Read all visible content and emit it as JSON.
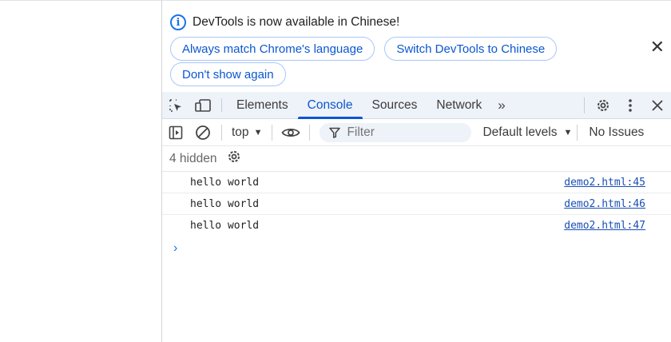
{
  "infobar": {
    "message": "DevTools is now available in Chinese!",
    "buttons": [
      "Always match Chrome's language",
      "Switch DevTools to Chinese",
      "Don't show again"
    ],
    "close_symbol": "✕"
  },
  "tabs": {
    "items": [
      "Elements",
      "Console",
      "Sources",
      "Network"
    ],
    "active": "Console",
    "more_symbol": "»"
  },
  "console_toolbar": {
    "context": "top",
    "filter_placeholder": "Filter",
    "levels": "Default levels",
    "issues": "No Issues"
  },
  "hidden": {
    "label": "4 hidden"
  },
  "log": [
    {
      "message": "hello world",
      "source": "demo2.html:45"
    },
    {
      "message": "hello world",
      "source": "demo2.html:46"
    },
    {
      "message": "hello world",
      "source": "demo2.html:47"
    }
  ],
  "prompt_symbol": "›",
  "colors": {
    "accent": "#0b57d0",
    "tabbar_bg": "#eef2f9",
    "link": "#1a4fb5"
  }
}
